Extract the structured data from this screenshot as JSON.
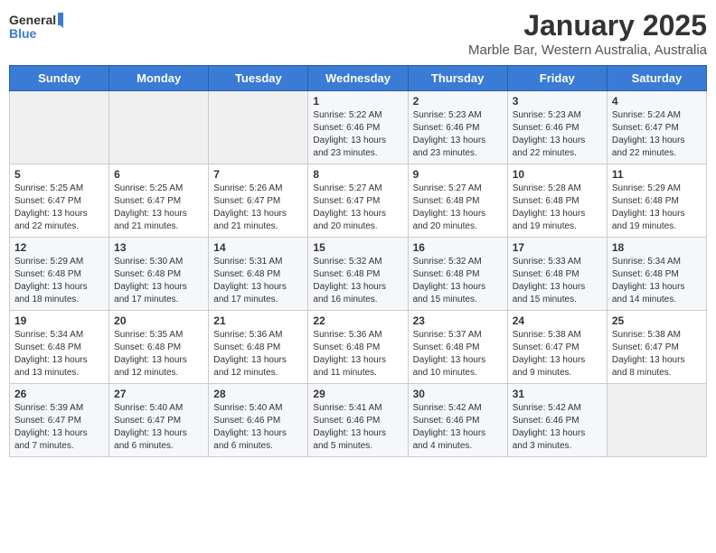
{
  "header": {
    "logo_general": "General",
    "logo_blue": "Blue",
    "title": "January 2025",
    "subtitle": "Marble Bar, Western Australia, Australia"
  },
  "days_of_week": [
    "Sunday",
    "Monday",
    "Tuesday",
    "Wednesday",
    "Thursday",
    "Friday",
    "Saturday"
  ],
  "weeks": [
    [
      {
        "day": "",
        "info": ""
      },
      {
        "day": "",
        "info": ""
      },
      {
        "day": "",
        "info": ""
      },
      {
        "day": "1",
        "info": "Sunrise: 5:22 AM\nSunset: 6:46 PM\nDaylight: 13 hours and 23 minutes."
      },
      {
        "day": "2",
        "info": "Sunrise: 5:23 AM\nSunset: 6:46 PM\nDaylight: 13 hours and 23 minutes."
      },
      {
        "day": "3",
        "info": "Sunrise: 5:23 AM\nSunset: 6:46 PM\nDaylight: 13 hours and 22 minutes."
      },
      {
        "day": "4",
        "info": "Sunrise: 5:24 AM\nSunset: 6:47 PM\nDaylight: 13 hours and 22 minutes."
      }
    ],
    [
      {
        "day": "5",
        "info": "Sunrise: 5:25 AM\nSunset: 6:47 PM\nDaylight: 13 hours and 22 minutes."
      },
      {
        "day": "6",
        "info": "Sunrise: 5:25 AM\nSunset: 6:47 PM\nDaylight: 13 hours and 21 minutes."
      },
      {
        "day": "7",
        "info": "Sunrise: 5:26 AM\nSunset: 6:47 PM\nDaylight: 13 hours and 21 minutes."
      },
      {
        "day": "8",
        "info": "Sunrise: 5:27 AM\nSunset: 6:47 PM\nDaylight: 13 hours and 20 minutes."
      },
      {
        "day": "9",
        "info": "Sunrise: 5:27 AM\nSunset: 6:48 PM\nDaylight: 13 hours and 20 minutes."
      },
      {
        "day": "10",
        "info": "Sunrise: 5:28 AM\nSunset: 6:48 PM\nDaylight: 13 hours and 19 minutes."
      },
      {
        "day": "11",
        "info": "Sunrise: 5:29 AM\nSunset: 6:48 PM\nDaylight: 13 hours and 19 minutes."
      }
    ],
    [
      {
        "day": "12",
        "info": "Sunrise: 5:29 AM\nSunset: 6:48 PM\nDaylight: 13 hours and 18 minutes."
      },
      {
        "day": "13",
        "info": "Sunrise: 5:30 AM\nSunset: 6:48 PM\nDaylight: 13 hours and 17 minutes."
      },
      {
        "day": "14",
        "info": "Sunrise: 5:31 AM\nSunset: 6:48 PM\nDaylight: 13 hours and 17 minutes."
      },
      {
        "day": "15",
        "info": "Sunrise: 5:32 AM\nSunset: 6:48 PM\nDaylight: 13 hours and 16 minutes."
      },
      {
        "day": "16",
        "info": "Sunrise: 5:32 AM\nSunset: 6:48 PM\nDaylight: 13 hours and 15 minutes."
      },
      {
        "day": "17",
        "info": "Sunrise: 5:33 AM\nSunset: 6:48 PM\nDaylight: 13 hours and 15 minutes."
      },
      {
        "day": "18",
        "info": "Sunrise: 5:34 AM\nSunset: 6:48 PM\nDaylight: 13 hours and 14 minutes."
      }
    ],
    [
      {
        "day": "19",
        "info": "Sunrise: 5:34 AM\nSunset: 6:48 PM\nDaylight: 13 hours and 13 minutes."
      },
      {
        "day": "20",
        "info": "Sunrise: 5:35 AM\nSunset: 6:48 PM\nDaylight: 13 hours and 12 minutes."
      },
      {
        "day": "21",
        "info": "Sunrise: 5:36 AM\nSunset: 6:48 PM\nDaylight: 13 hours and 12 minutes."
      },
      {
        "day": "22",
        "info": "Sunrise: 5:36 AM\nSunset: 6:48 PM\nDaylight: 13 hours and 11 minutes."
      },
      {
        "day": "23",
        "info": "Sunrise: 5:37 AM\nSunset: 6:48 PM\nDaylight: 13 hours and 10 minutes."
      },
      {
        "day": "24",
        "info": "Sunrise: 5:38 AM\nSunset: 6:47 PM\nDaylight: 13 hours and 9 minutes."
      },
      {
        "day": "25",
        "info": "Sunrise: 5:38 AM\nSunset: 6:47 PM\nDaylight: 13 hours and 8 minutes."
      }
    ],
    [
      {
        "day": "26",
        "info": "Sunrise: 5:39 AM\nSunset: 6:47 PM\nDaylight: 13 hours and 7 minutes."
      },
      {
        "day": "27",
        "info": "Sunrise: 5:40 AM\nSunset: 6:47 PM\nDaylight: 13 hours and 6 minutes."
      },
      {
        "day": "28",
        "info": "Sunrise: 5:40 AM\nSunset: 6:46 PM\nDaylight: 13 hours and 6 minutes."
      },
      {
        "day": "29",
        "info": "Sunrise: 5:41 AM\nSunset: 6:46 PM\nDaylight: 13 hours and 5 minutes."
      },
      {
        "day": "30",
        "info": "Sunrise: 5:42 AM\nSunset: 6:46 PM\nDaylight: 13 hours and 4 minutes."
      },
      {
        "day": "31",
        "info": "Sunrise: 5:42 AM\nSunset: 6:46 PM\nDaylight: 13 hours and 3 minutes."
      },
      {
        "day": "",
        "info": ""
      }
    ]
  ]
}
